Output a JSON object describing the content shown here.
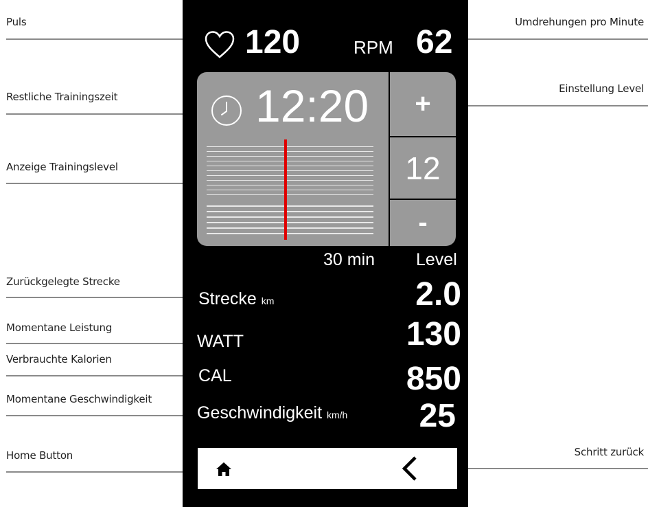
{
  "annotations": {
    "puls": "Puls",
    "restzeit": "Restliche Trainingszeit",
    "trainingslevel": "Anzeige Trainingslevel",
    "strecke": "Zurückgelegte Strecke",
    "leistung": "Momentane Leistung",
    "kalorien": "Verbrauchte Kalorien",
    "geschwindigkeit": "Momentane Geschwindigkeit",
    "home": "Home Button",
    "rpm": "Umdrehungen pro Minute",
    "level": "Einstellung Level",
    "zurueck": "Schritt zurück"
  },
  "device": {
    "pulse": "120",
    "rpm_label": "RPM",
    "rpm": "62",
    "time": "12:20",
    "duration_label": "30 min",
    "level_label": "Level",
    "level": {
      "plus": "+",
      "value": "12",
      "minus": "-"
    },
    "metrics": {
      "distance": {
        "label": "Strecke",
        "unit": "km",
        "value": "2.0"
      },
      "power": {
        "label": "WATT",
        "value": "130"
      },
      "calories": {
        "label": "CAL",
        "value": "850"
      },
      "speed": {
        "label": "Geschwindigkeit",
        "unit": "km/h",
        "value": "25"
      }
    },
    "bottom": {
      "home_icon": "home-icon",
      "back_icon": "chevron-left-icon"
    },
    "colors": {
      "background": "#000000",
      "panel": "#9a9a9a",
      "marker": "#e00000"
    }
  }
}
